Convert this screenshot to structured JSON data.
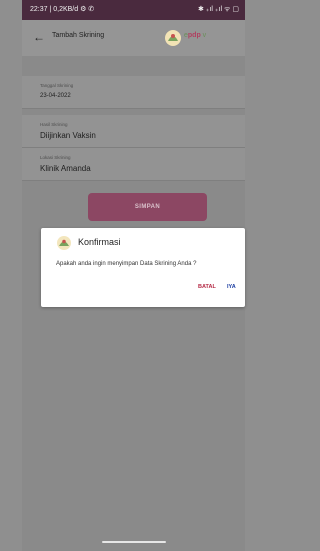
{
  "status_bar": {
    "time_info": "22:37 | 0,2KB/d ⚙ ✆",
    "indicators": "✱ ₊ıl ₊ıl ᯤ ▢"
  },
  "app_bar": {
    "title": "Tambah Skrining",
    "logo_text_prefix": "e",
    "logo_text_main": "pdp",
    "logo_text_suffix": " v"
  },
  "form": {
    "fields": [
      {
        "label": "Tanggal Skrining",
        "value": "23-04-2022"
      },
      {
        "label": "Hasil Skrining",
        "value": "Diijinkan Vaksin"
      },
      {
        "label": "Lokasi Skrining",
        "value": "Klinik Amanda"
      }
    ],
    "save_label": "SIMPAN"
  },
  "dialog": {
    "title": "Konfirmasi",
    "message": "Apakah anda ingin menyimpan Data Skrining Anda ?",
    "cancel_label": "BATAL",
    "confirm_label": "IYA"
  },
  "colors": {
    "status_bar": "#4a2a3e",
    "primary_button": "#8c4763",
    "cancel": "#b52a45",
    "confirm": "#1d3fa3"
  }
}
